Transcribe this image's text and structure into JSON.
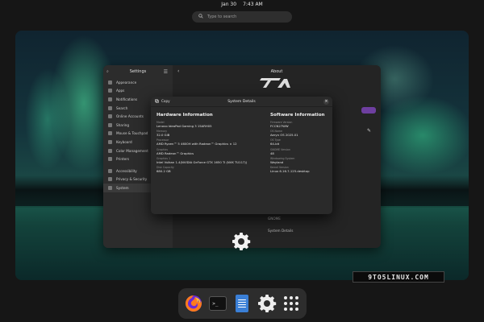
{
  "topbar": {
    "date": "Jan 30",
    "time": "7:43 AM"
  },
  "search": {
    "placeholder": "Type to search"
  },
  "settings": {
    "title": "Settings",
    "sidebar": [
      {
        "label": "Appearance",
        "icon": "appearance-icon"
      },
      {
        "label": "Apps",
        "icon": "apps-icon"
      },
      {
        "label": "Notifications",
        "icon": "bell-icon"
      },
      {
        "label": "Search",
        "icon": "search-icon"
      },
      {
        "label": "Online Accounts",
        "icon": "accounts-icon"
      },
      {
        "label": "Sharing",
        "icon": "share-icon"
      },
      {
        "label": "Mouse & Touchpad",
        "icon": "mouse-icon"
      },
      {
        "label": "Keyboard",
        "icon": "keyboard-icon"
      },
      {
        "label": "Color Management",
        "icon": "color-icon"
      },
      {
        "label": "Printers",
        "icon": "printer-icon"
      },
      {
        "label": "Accessibility",
        "icon": "accessibility-icon"
      },
      {
        "label": "Privacy & Security",
        "icon": "shield-icon"
      },
      {
        "label": "System",
        "icon": "gear-icon"
      }
    ],
    "page_title": "About",
    "rows": [
      "GNOME",
      "System Details"
    ]
  },
  "dialog": {
    "title": "System Details",
    "copy_label": "Copy",
    "hardware": {
      "title": "Hardware Information",
      "entries": [
        {
          "label": "Model",
          "value": "Lenovo IdeaPad Gaming 3 15ARH05"
        },
        {
          "label": "Memory",
          "value": "32.0 GiB"
        },
        {
          "label": "Processor",
          "value": "AMD Ryzen™ 5 4600H with Radeon™ Graphics × 12"
        },
        {
          "label": "Graphics",
          "value": "AMD Radeon™ Graphics"
        },
        {
          "label": "Graphics 1",
          "value": "Intel Vulkan 1.4(NVIDIA GeForce GTX 1650 Ti (NVK TU117))"
        },
        {
          "label": "Disk Capacity",
          "value": "680.2 GB"
        }
      ]
    },
    "software": {
      "title": "Software Information",
      "entries": [
        {
          "label": "Firmware Version",
          "value": "FCCN27WW"
        },
        {
          "label": "OS Name",
          "value": "Aeryn OS 2025.01"
        },
        {
          "label": "OS Type",
          "value": "64-bit"
        },
        {
          "label": "GNOME Version",
          "value": "48"
        },
        {
          "label": "Windowing System",
          "value": "Wayland"
        },
        {
          "label": "Kernel Version",
          "value": "Linux 6.16.7-125.desktop"
        }
      ]
    }
  },
  "watermark": "9TO5LINUX.COM",
  "dock": [
    {
      "name": "firefox",
      "icon": "firefox-icon"
    },
    {
      "name": "terminal",
      "icon": "terminal-icon",
      "glyph": ">_"
    },
    {
      "name": "text-editor",
      "icon": "text-editor-icon"
    },
    {
      "name": "settings",
      "icon": "gear-icon"
    },
    {
      "name": "show-apps",
      "icon": "app-grid-icon"
    }
  ],
  "colors": {
    "accent": "#6e3fa0",
    "firefox_orange": "#ff7b1c",
    "editor_blue": "#3a7fd6"
  }
}
